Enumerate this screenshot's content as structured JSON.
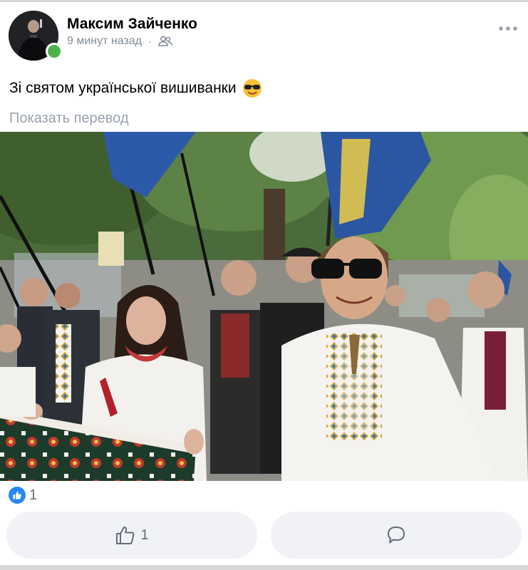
{
  "post": {
    "author": "Максим Зайченко",
    "time": "9 минут назад",
    "separator": "·",
    "audience_icon": "friends-icon",
    "text": "Зі святом української вишиванки",
    "emoji": "sunglasses-face-emoji",
    "translate_label": "Показать перевод",
    "photo_icon": "street-march-photo"
  },
  "reactions": {
    "summary_icon": "like-reaction-icon",
    "summary_count": "1"
  },
  "actions": {
    "like_icon": "thumbs-up-icon",
    "like_count": "1",
    "comment_icon": "comment-icon"
  },
  "colors": {
    "online": "#4bb34b",
    "reaction_blue": "#2787f5",
    "secondary_text": "#818c99",
    "button_bg": "#f0f2f5"
  }
}
